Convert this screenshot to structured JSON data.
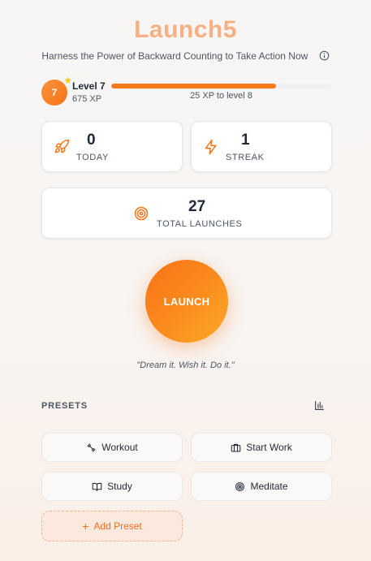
{
  "header": {
    "title": "Launch5",
    "subtitle": "Harness the Power of Backward Counting to Take Action Now",
    "info_icon": "info-icon"
  },
  "level": {
    "badge_number": "7",
    "level_label": "Level 7",
    "xp_label": "675 XP",
    "progress_fraction": 0.75,
    "next_label": "25 XP to level 8"
  },
  "stats": {
    "today": {
      "value": "0",
      "label": "TODAY",
      "icon": "rocket-icon"
    },
    "streak": {
      "value": "1",
      "label": "STREAK",
      "icon": "lightning-icon"
    },
    "total": {
      "value": "27",
      "label": "TOTAL LAUNCHES",
      "icon": "target-icon"
    }
  },
  "launch": {
    "button_label": "LAUNCH",
    "quote": "\"Dream it. Wish it. Do it.\""
  },
  "presets": {
    "section_label": "PRESETS",
    "items": [
      {
        "label": "Workout",
        "icon": "dumbbell-icon"
      },
      {
        "label": "Start Work",
        "icon": "briefcase-icon"
      },
      {
        "label": "Study",
        "icon": "book-icon"
      },
      {
        "label": "Meditate",
        "icon": "target-icon"
      }
    ],
    "add_label": "Add Preset"
  },
  "colors": {
    "accent": "#f97316",
    "title": "#f6b083",
    "text": "#1f2937",
    "muted": "#4b5563"
  }
}
